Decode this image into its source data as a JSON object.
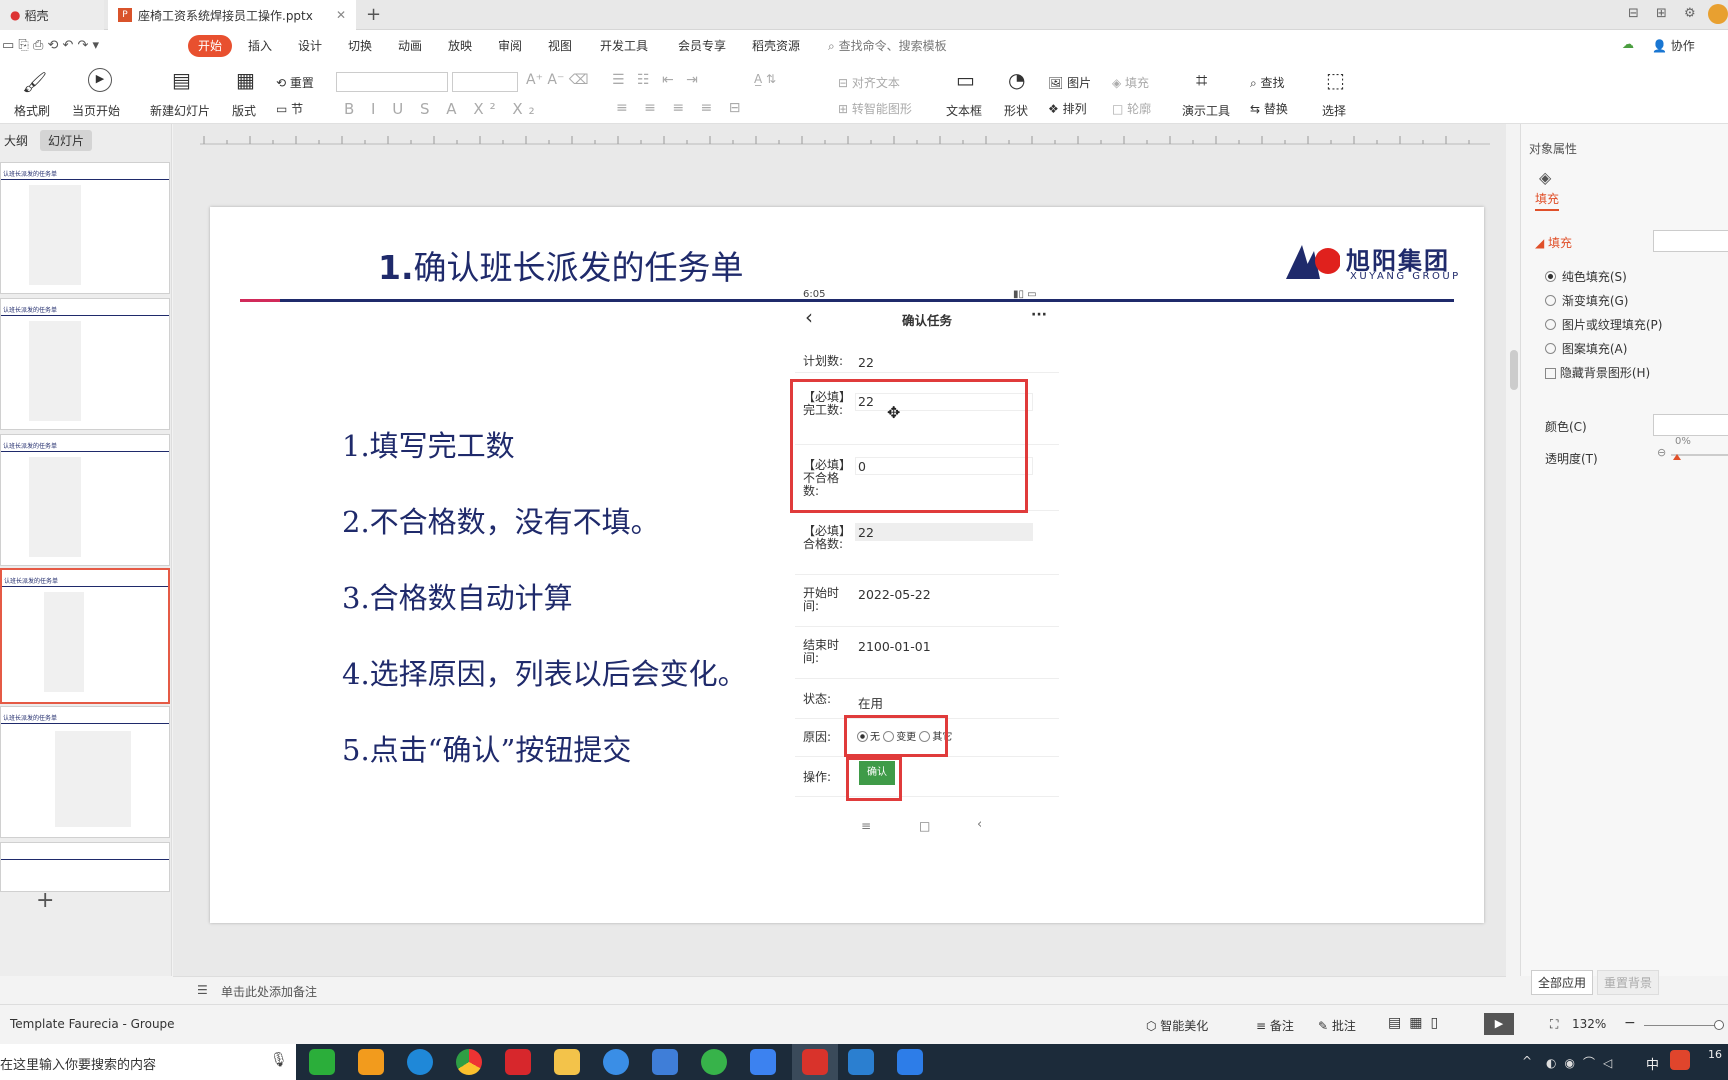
{
  "tabs": {
    "home": "稻壳",
    "doc": "座椅工资系统焊接员工操作.pptx"
  },
  "menu": {
    "start": "开始",
    "items": [
      "插入",
      "设计",
      "切换",
      "动画",
      "放映",
      "审阅",
      "视图",
      "开发工具",
      "会员专享",
      "稻壳资源"
    ],
    "search_placeholder": "查找命令、搜索模板",
    "collab": "协作"
  },
  "ribbon": {
    "format_painter": "格式刷",
    "from_current": "当页开始",
    "new_slide": "新建幻灯片",
    "layout": "版式",
    "reset": "重置",
    "section": "节",
    "text_direction": "对齐文本",
    "smart_art": "转智能图形",
    "textbox": "文本框",
    "shape": "形状",
    "picture": "图片",
    "arrange": "排列",
    "fill": "填充",
    "outline": "轮廓",
    "present_tools": "演示工具",
    "find": "查找",
    "replace": "替换",
    "select": "选择"
  },
  "left_pane": {
    "outline_tab": "大纲",
    "slides_tab": "幻灯片",
    "thumb_title": "认班长派发的任务单"
  },
  "slide": {
    "title_num": "1.",
    "title_text": "确认班长派发的任务单",
    "logo_cn": "旭阳集团",
    "logo_en": "XUYANG GROUP",
    "steps": [
      "1.填写完工数",
      "2.不合格数，没有不填。",
      "3.合格数自动计算",
      "4.选择原因，列表以后会变化。",
      "5.点击“确认”按钮提交"
    ]
  },
  "phone": {
    "time": "6:05",
    "header": "确认任务",
    "plan_label": "计划数:",
    "plan_value": "22",
    "done_label": "【必填】完工数:",
    "done_value": "22",
    "bad_label": "【必填】不合格数:",
    "bad_value": "0",
    "good_label": "【必填】合格数:",
    "good_value": "22",
    "start_label": "开始时间:",
    "start_value": "2022-05-22",
    "end_label": "结束时间:",
    "end_value": "2100-01-01",
    "status_label": "状态:",
    "status_value": "在用",
    "reason_label": "原因:",
    "reason_options": [
      "无",
      "变更",
      "其它"
    ],
    "action_label": "操作:",
    "confirm": "确认"
  },
  "right_pane": {
    "title": "对象属性",
    "fill_tab": "填充",
    "fill_section": "填充",
    "options": [
      "纯色填充(S)",
      "渐变填充(G)",
      "图片或纹理填充(P)",
      "图案填充(A)"
    ],
    "hide_bg": "隐藏背景图形(H)",
    "color_label": "颜色(C)",
    "transparency_label": "透明度(T)",
    "transparency_value": "0%",
    "apply_all": "全部应用",
    "reset_bg": "重置背景"
  },
  "notes": "单击此处添加备注",
  "status": {
    "template": "Template Faurecia - Groupe",
    "beautify": "智能美化",
    "notes_btn": "备注",
    "comments": "批注",
    "zoom": "132%"
  },
  "taskbar": {
    "search": "在这里输入你要搜索的内容",
    "ime": "中",
    "clock": "16"
  }
}
